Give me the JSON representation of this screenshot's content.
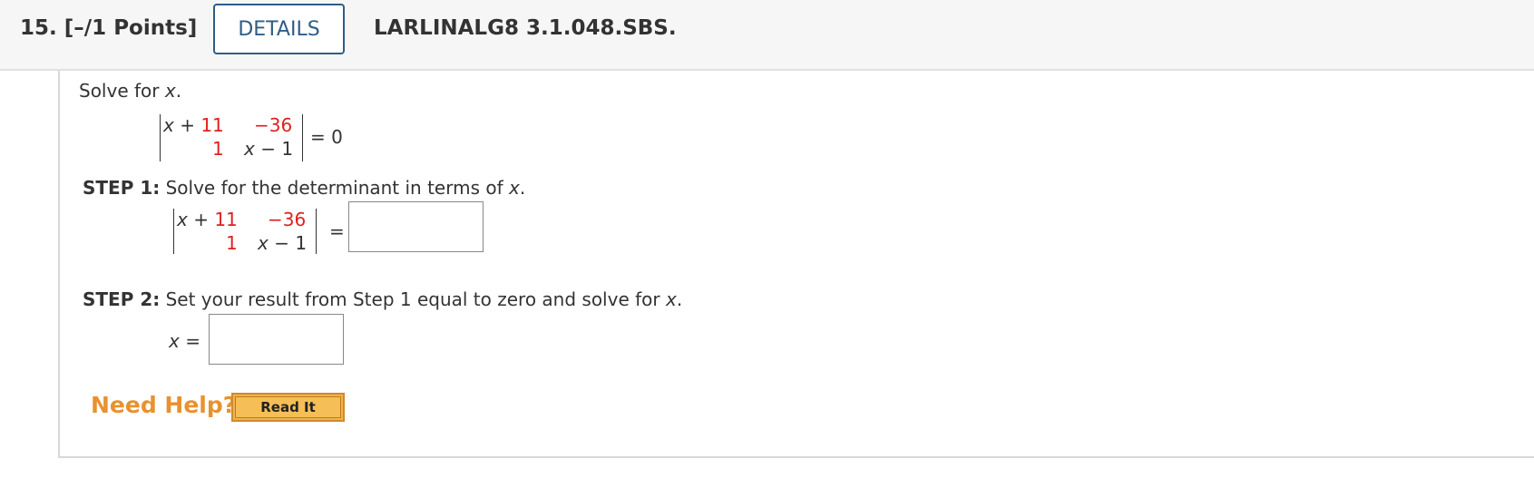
{
  "header": {
    "question_number": "15.",
    "points": "[–/1 Points]",
    "details_label": "DETAILS",
    "problem_code": "LARLINALG8 3.1.048.SBS."
  },
  "problem": {
    "prompt_prefix": "Solve for ",
    "prompt_var": "x",
    "prompt_suffix": ".",
    "matrix": {
      "a_var": "x",
      "a_op": " + ",
      "a_num": "11",
      "b": "−36",
      "c": "1",
      "d_var": "x",
      "d_rest": " − 1"
    },
    "equals_zero": "= 0"
  },
  "step1": {
    "label": "STEP 1:",
    "text_prefix": " Solve for the determinant in terms of ",
    "text_var": "x",
    "text_suffix": ".",
    "equals": "="
  },
  "step2": {
    "label": "STEP 2:",
    "text_prefix": " Set your result from Step 1 equal to zero and solve for ",
    "text_var": "x",
    "text_suffix": ".",
    "answer_var": "x",
    "answer_eq": " ="
  },
  "help": {
    "need_help": "Need Help?",
    "read_it": "Read It"
  },
  "colors": {
    "accent_blue": "#2e5d8a",
    "value_red": "#e02020",
    "help_orange": "#e8922e"
  }
}
